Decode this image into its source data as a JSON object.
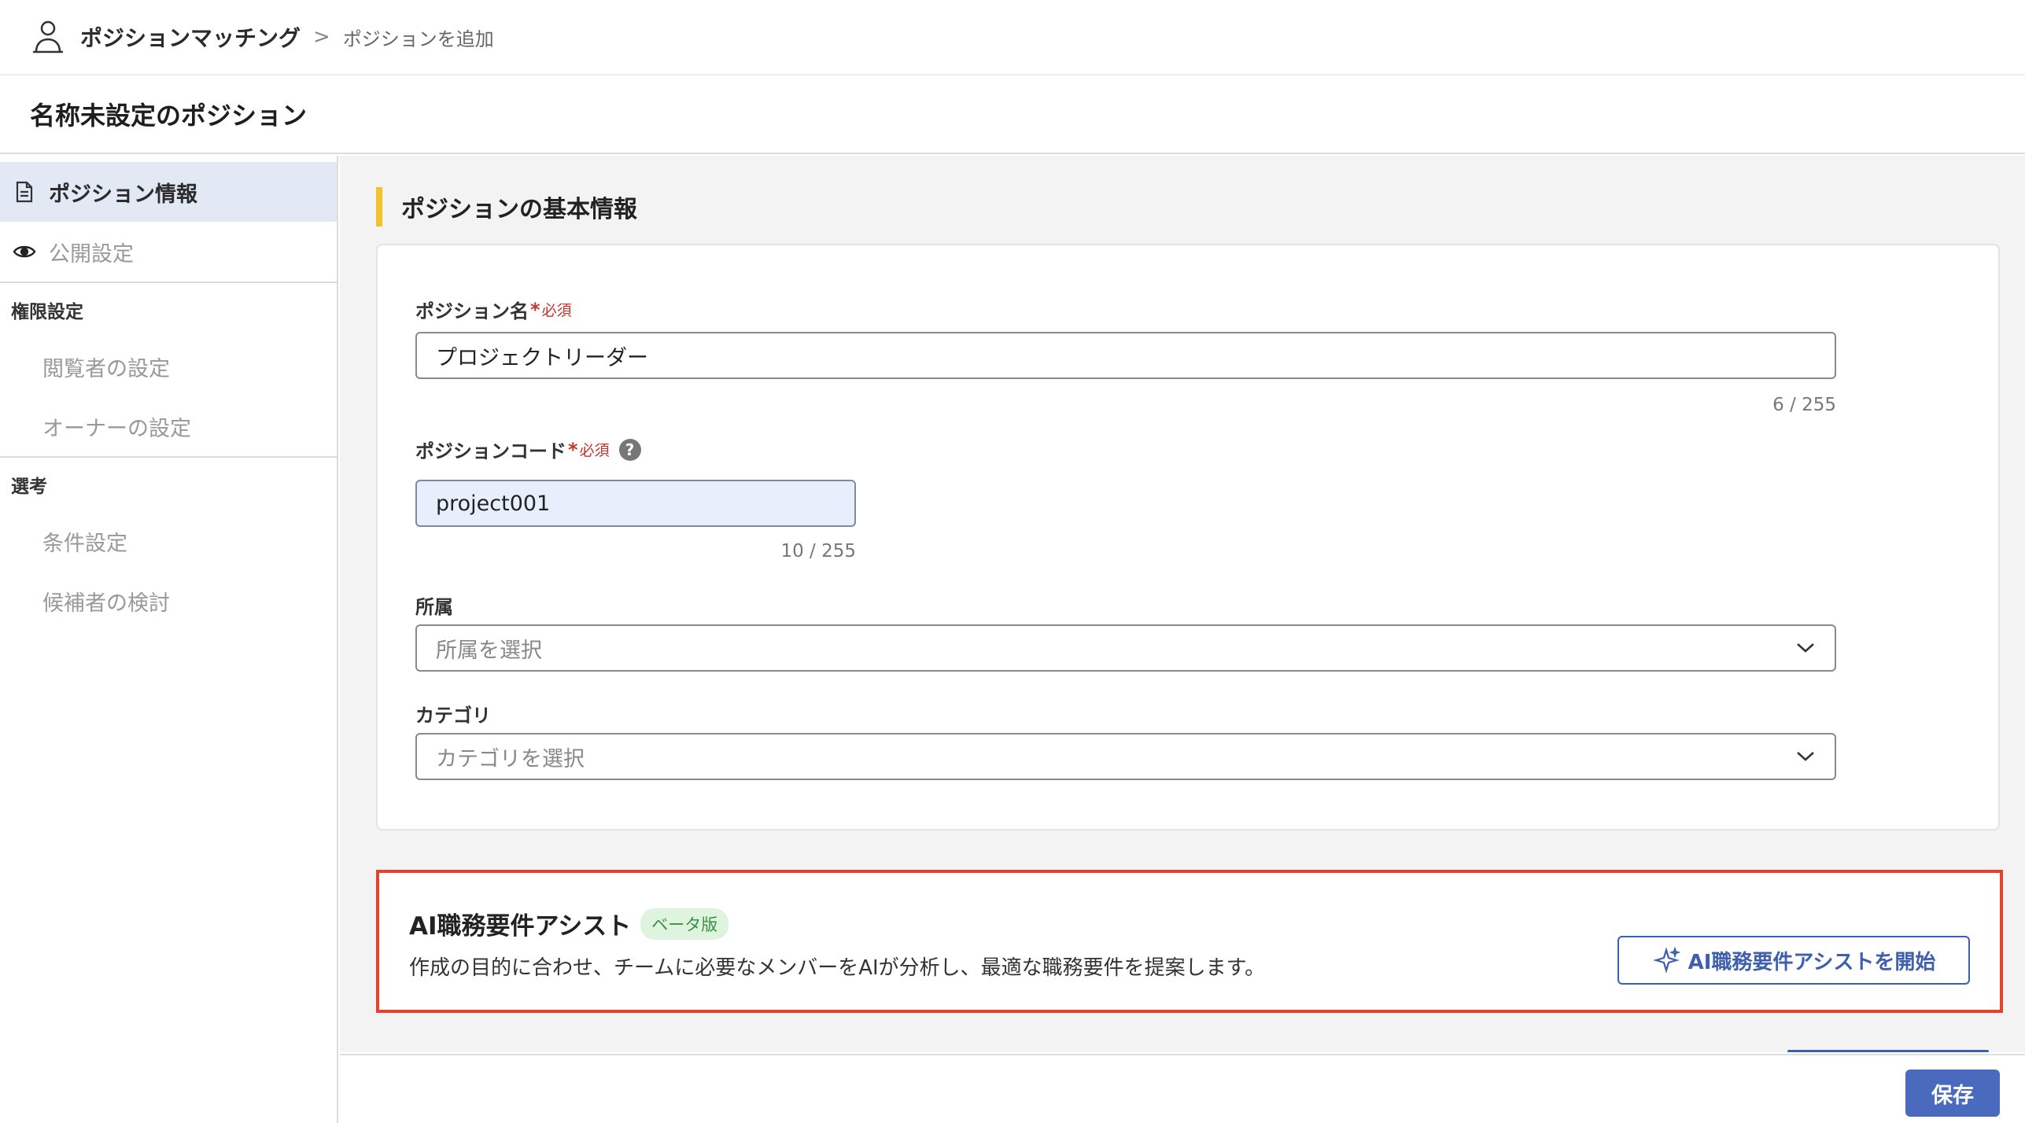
{
  "header": {
    "app_name": "ポジションマッチング",
    "breadcrumb_separator": ">",
    "breadcrumb_current": "ポジションを追加"
  },
  "page": {
    "title": "名称未設定のポジション"
  },
  "sidebar": {
    "items": [
      {
        "label": "ポジション情報",
        "icon": "document-icon",
        "active": true
      },
      {
        "label": "公開設定",
        "icon": "eye-icon",
        "active": false
      }
    ],
    "groups": [
      {
        "label": "権限設定",
        "items": [
          "閲覧者の設定",
          "オーナーの設定"
        ]
      },
      {
        "label": "選考",
        "items": [
          "条件設定",
          "候補者の検討"
        ]
      }
    ]
  },
  "section": {
    "title": "ポジションの基本情報"
  },
  "form": {
    "position_name": {
      "label": "ポジション名",
      "required_mark": "*",
      "required_text": "必須",
      "value": "プロジェクトリーダー",
      "counter": "6 / 255"
    },
    "position_code": {
      "label": "ポジションコード",
      "required_mark": "*",
      "required_text": "必須",
      "help": "?",
      "value": "project001",
      "counter": "10 / 255"
    },
    "affiliation": {
      "label": "所属",
      "placeholder": "所属を選択"
    },
    "category": {
      "label": "カテゴリ",
      "placeholder": "カテゴリを選択"
    }
  },
  "ai_assist": {
    "title": "AI職務要件アシスト",
    "badge": "ベータ版",
    "description": "作成の目的に合わせ、チームに必要なメンバーをAIが分析し、最適な職務要件を提案します。",
    "button_label": "AI職務要件アシストを開始"
  },
  "footer": {
    "save_label": "保存"
  },
  "colors": {
    "accent": "#4a6bbd",
    "section_marker": "#f3c22b",
    "required": "#c8332b",
    "highlight_border": "#e0442f",
    "beta_bg": "#dff4de",
    "beta_text": "#3e8e41"
  }
}
